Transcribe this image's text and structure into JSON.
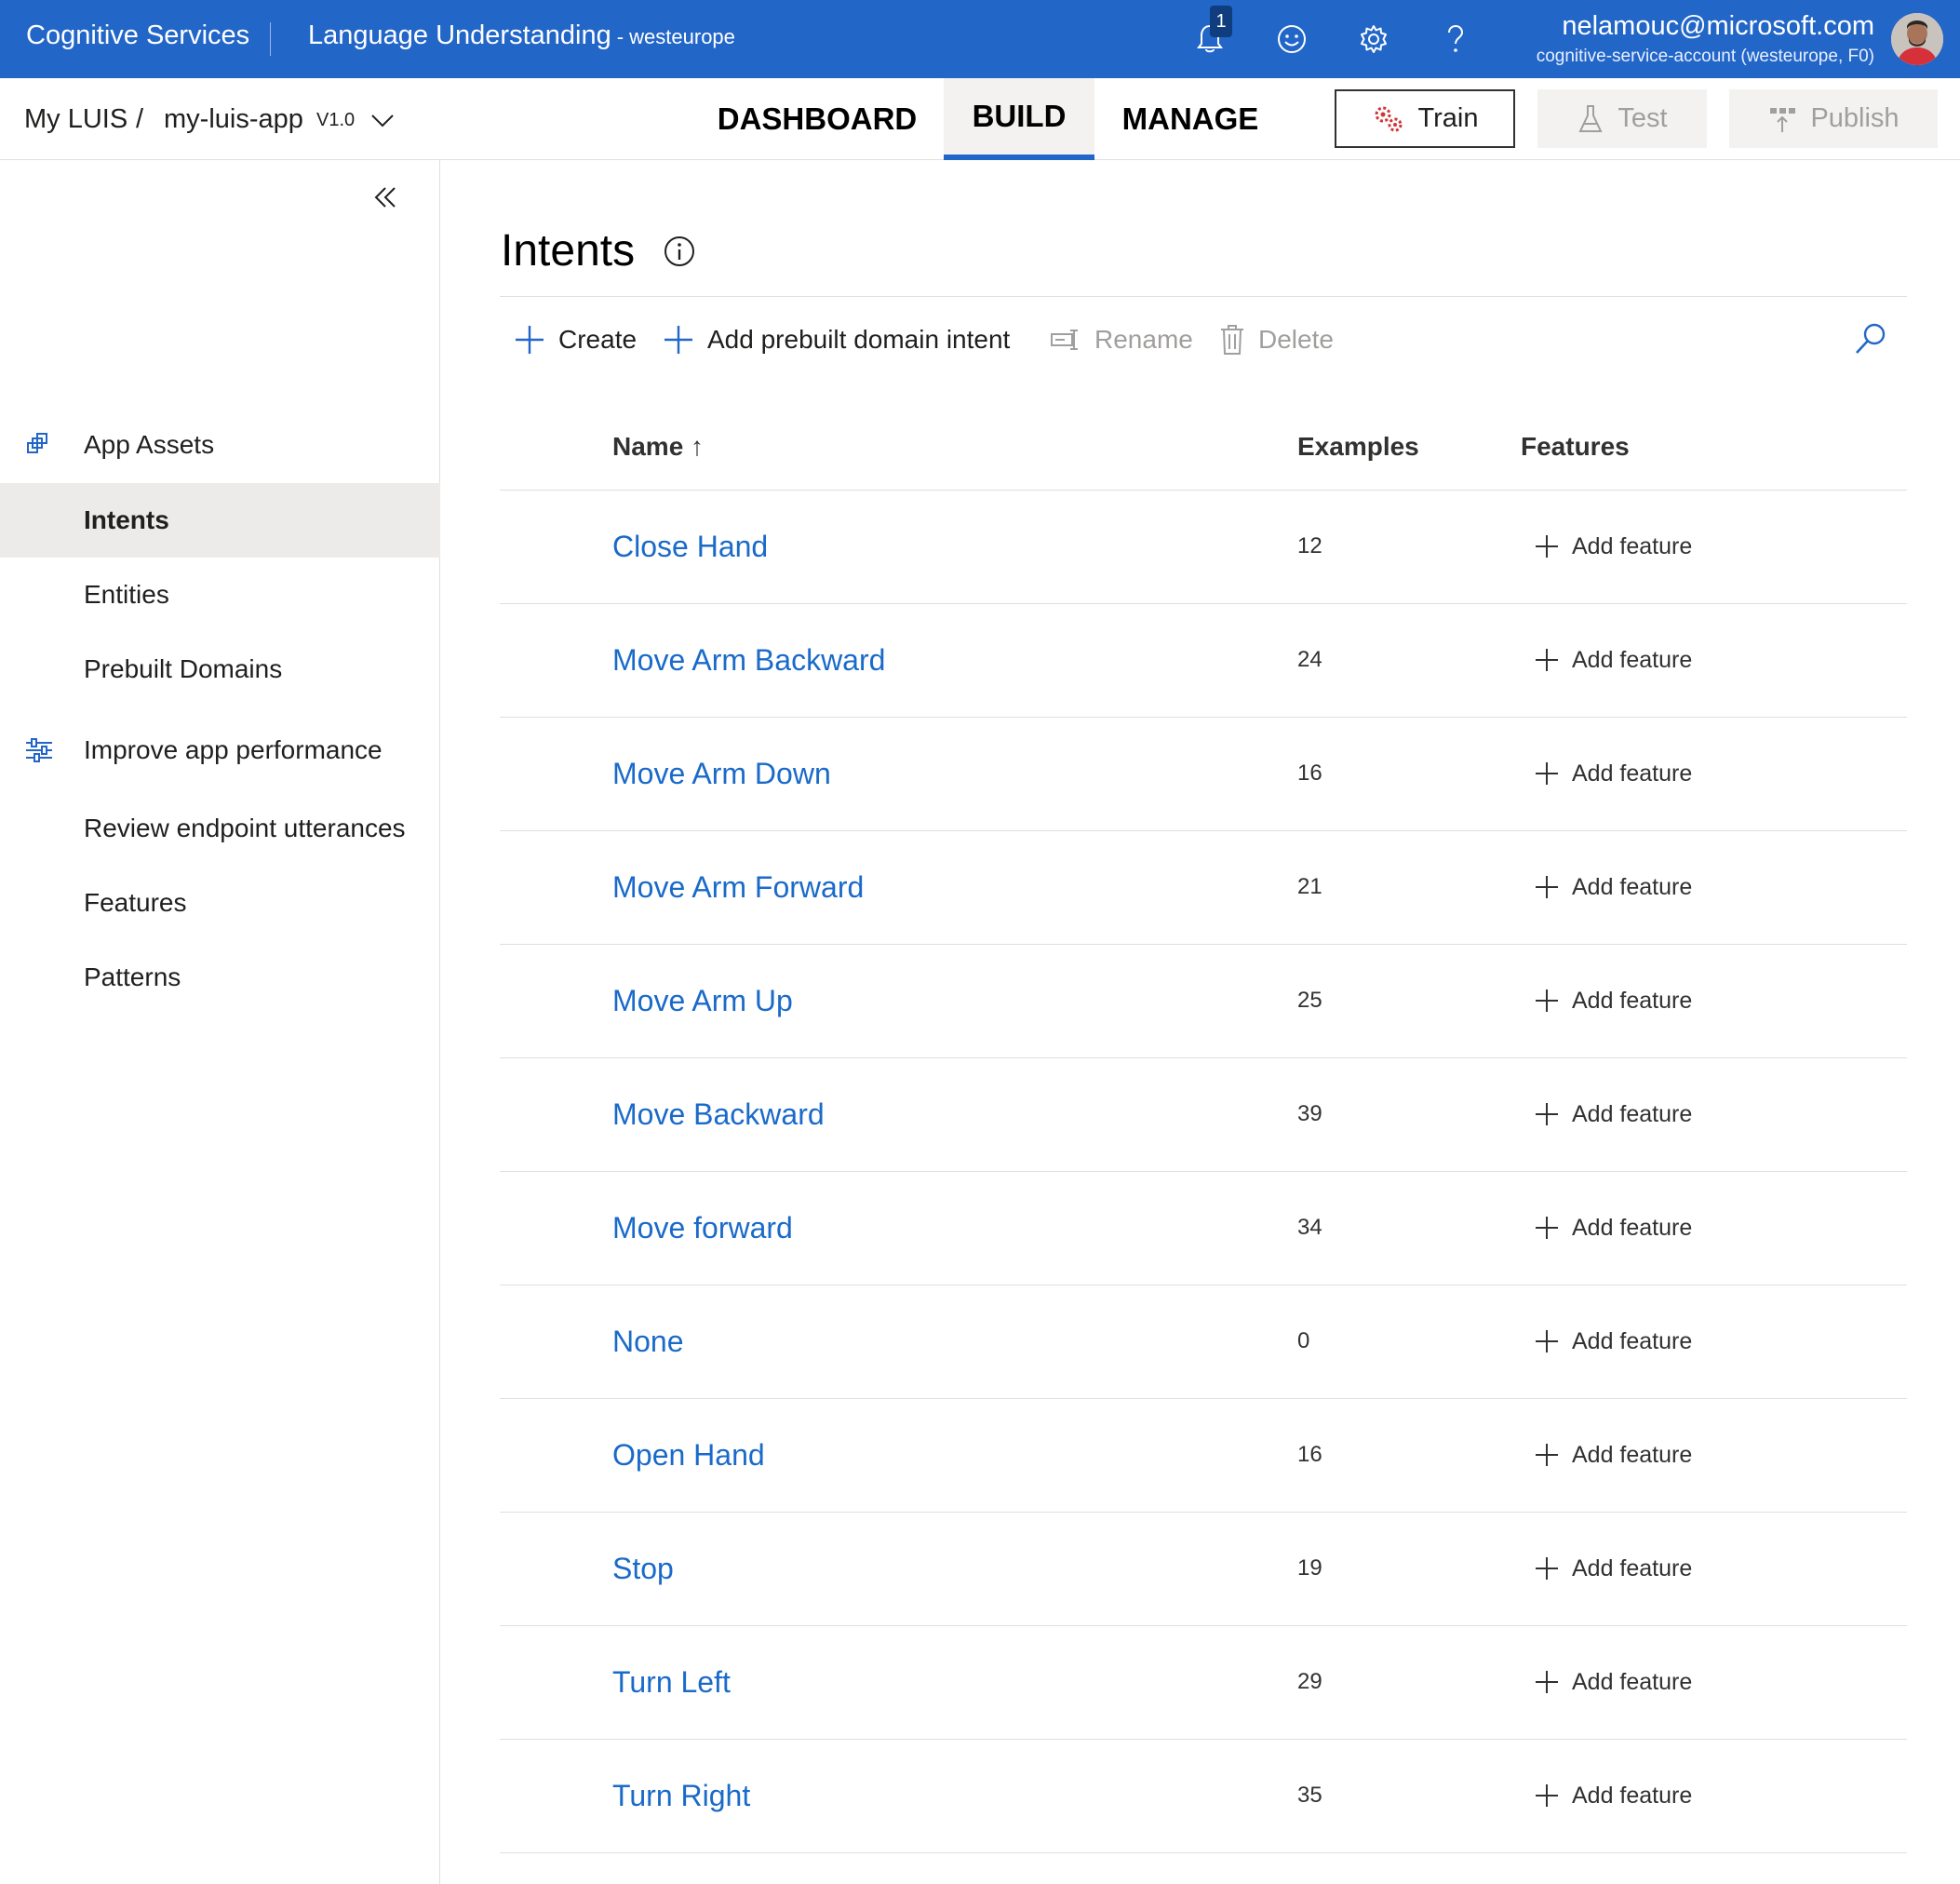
{
  "header": {
    "brand": "Cognitive Services",
    "product": "Language Understanding",
    "region": "- westeurope",
    "notification_count": "1",
    "user_email": "nelamouc@microsoft.com",
    "user_account": "cognitive-service-account (westeurope, F0)",
    "icons": [
      "bell-icon",
      "smiley-icon",
      "gear-icon",
      "help-icon"
    ]
  },
  "subnav": {
    "breadcrumb_root": "My LUIS",
    "breadcrumb_sep": "/",
    "app_name": "my-luis-app",
    "version": "V1.0",
    "tabs": [
      {
        "label": "DASHBOARD",
        "active": false
      },
      {
        "label": "BUILD",
        "active": true
      },
      {
        "label": "MANAGE",
        "active": false
      }
    ],
    "train_label": "Train",
    "test_label": "Test",
    "publish_label": "Publish"
  },
  "sidebar": {
    "groups": [
      {
        "label": "App Assets",
        "icon": "app-assets-icon",
        "items": [
          {
            "label": "Intents",
            "active": true
          },
          {
            "label": "Entities",
            "active": false
          },
          {
            "label": "Prebuilt Domains",
            "active": false
          }
        ]
      },
      {
        "label": "Improve app performance",
        "icon": "sliders-icon",
        "items": [
          {
            "label": "Review endpoint utterances",
            "active": false
          },
          {
            "label": "Features",
            "active": false
          },
          {
            "label": "Patterns",
            "active": false
          }
        ]
      }
    ]
  },
  "main": {
    "title": "Intents",
    "commands": {
      "create": "Create",
      "add_prebuilt": "Add prebuilt domain intent",
      "rename": "Rename",
      "delete": "Delete"
    },
    "columns": {
      "name": "Name",
      "name_sort": "↑",
      "examples": "Examples",
      "features": "Features"
    },
    "add_feature_label": "Add feature",
    "rows": [
      {
        "name": "Close Hand",
        "examples": "12"
      },
      {
        "name": "Move Arm Backward",
        "examples": "24"
      },
      {
        "name": "Move Arm Down",
        "examples": "16"
      },
      {
        "name": "Move Arm Forward",
        "examples": "21"
      },
      {
        "name": "Move Arm Up",
        "examples": "25"
      },
      {
        "name": "Move Backward",
        "examples": "39"
      },
      {
        "name": "Move forward",
        "examples": "34"
      },
      {
        "name": "None",
        "examples": "0"
      },
      {
        "name": "Open Hand",
        "examples": "16"
      },
      {
        "name": "Stop",
        "examples": "19"
      },
      {
        "name": "Turn Left",
        "examples": "29"
      },
      {
        "name": "Turn Right",
        "examples": "35"
      }
    ]
  },
  "colors": {
    "header_blue": "#2266c8",
    "link_blue": "#1a6ac9",
    "train_icon_red": "#d13438"
  }
}
